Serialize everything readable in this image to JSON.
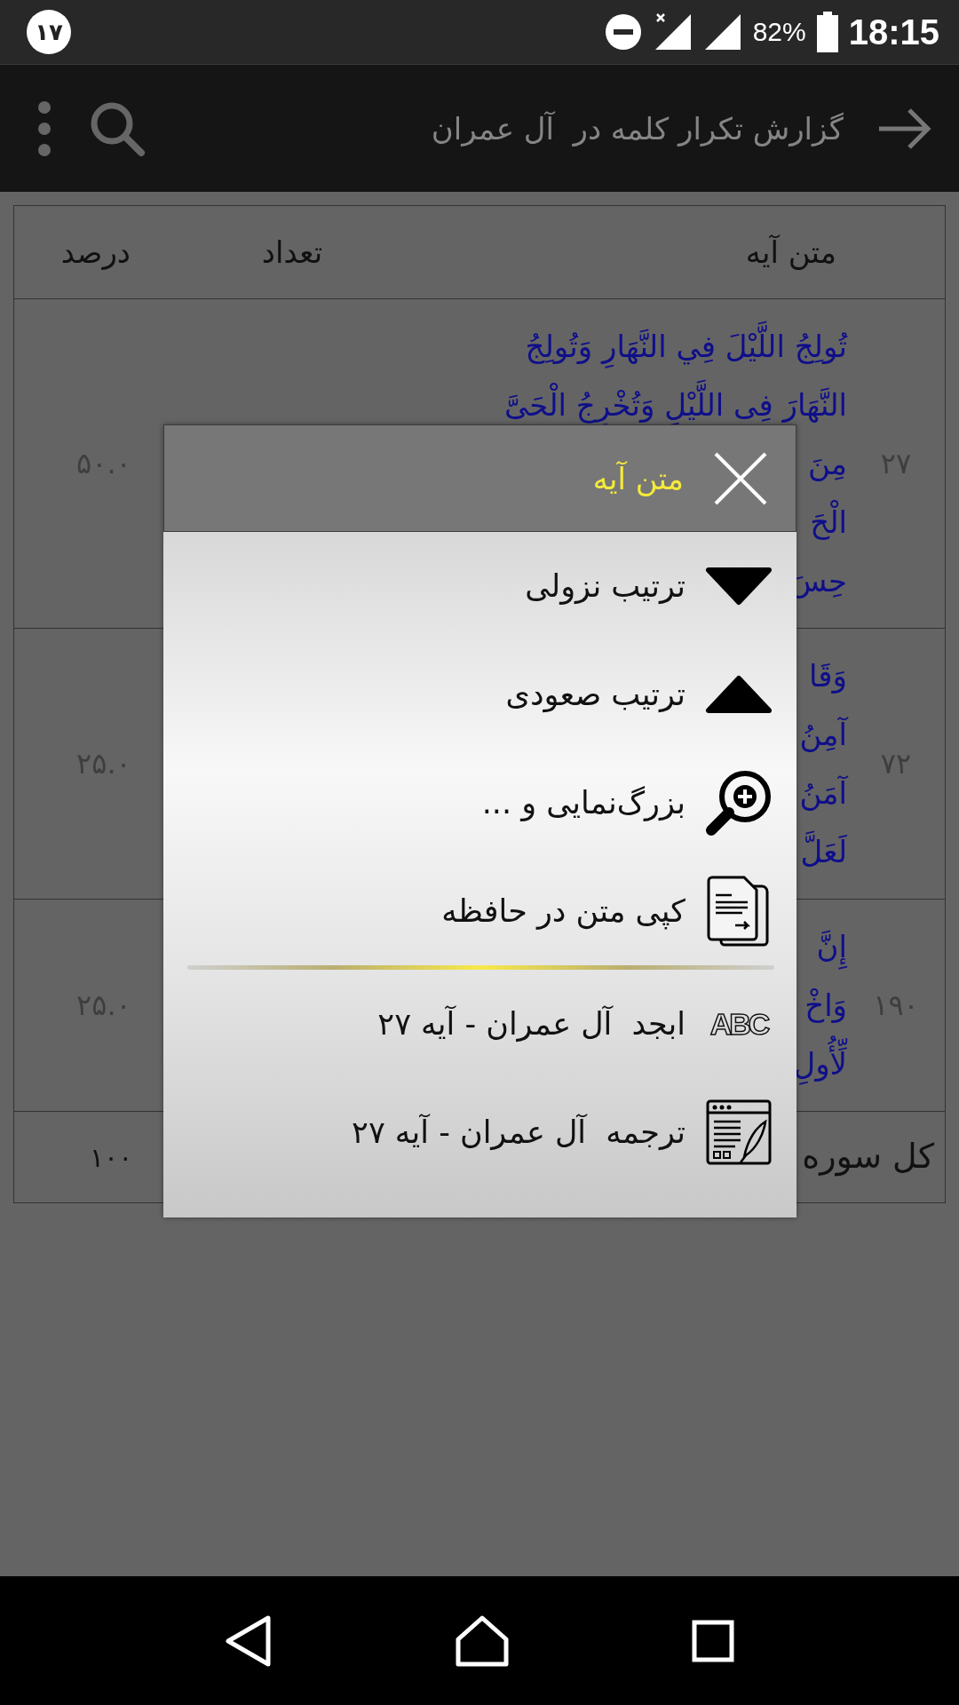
{
  "status_bar": {
    "notification": "۱۷",
    "battery": "82%",
    "time": "18:15"
  },
  "app_bar": {
    "title": "گزارش تکرار کلمه در  آل عمران"
  },
  "table": {
    "columns": [
      "متن آیه",
      "تعداد",
      "درصد"
    ],
    "rows": [
      {
        "number": "۲۷",
        "verse_lines": [
          "تُولِجُ اللَّيْلَ فِي النَّهَارِ وَتُولِجُ",
          "النَّهَارَ فِى اللَّيْلِ وَتُخْرِجُ الْحَىَّ",
          "مِنَ",
          "الْحَ",
          "حِسَ"
        ],
        "percent": "۵۰.۰"
      },
      {
        "number": "۷۲",
        "verse_lines": [
          "وَقَا",
          "آمِنُ",
          "آمَنُ",
          "لَعَلَّ"
        ],
        "percent": "۲۵.۰"
      },
      {
        "number": "۱۹۰",
        "verse_lines": [
          "إِنَّ",
          "وَاخْ",
          "لِّأُولِ"
        ],
        "percent": "۲۵.۰"
      }
    ],
    "total": {
      "label": "کل سوره",
      "percent": "۱۰۰"
    }
  },
  "dialog": {
    "title": "متن آیه",
    "sections": [
      {
        "items": [
          {
            "kind": "sort-desc",
            "label": "ترتیب نزولی"
          },
          {
            "kind": "sort-asc",
            "label": "ترتیب صعودی"
          },
          {
            "kind": "zoom",
            "label": "بزرگ‌نمایی و ..."
          },
          {
            "kind": "copy",
            "label": "کپی متن در حافظه"
          }
        ]
      },
      {
        "items": [
          {
            "kind": "abjad",
            "badge": "ABC",
            "label": "ابجد  آل عمران - آیه ۲۷"
          },
          {
            "kind": "translation",
            "label": "ترجمه  آل عمران - آیه ۲۷"
          }
        ]
      }
    ]
  }
}
